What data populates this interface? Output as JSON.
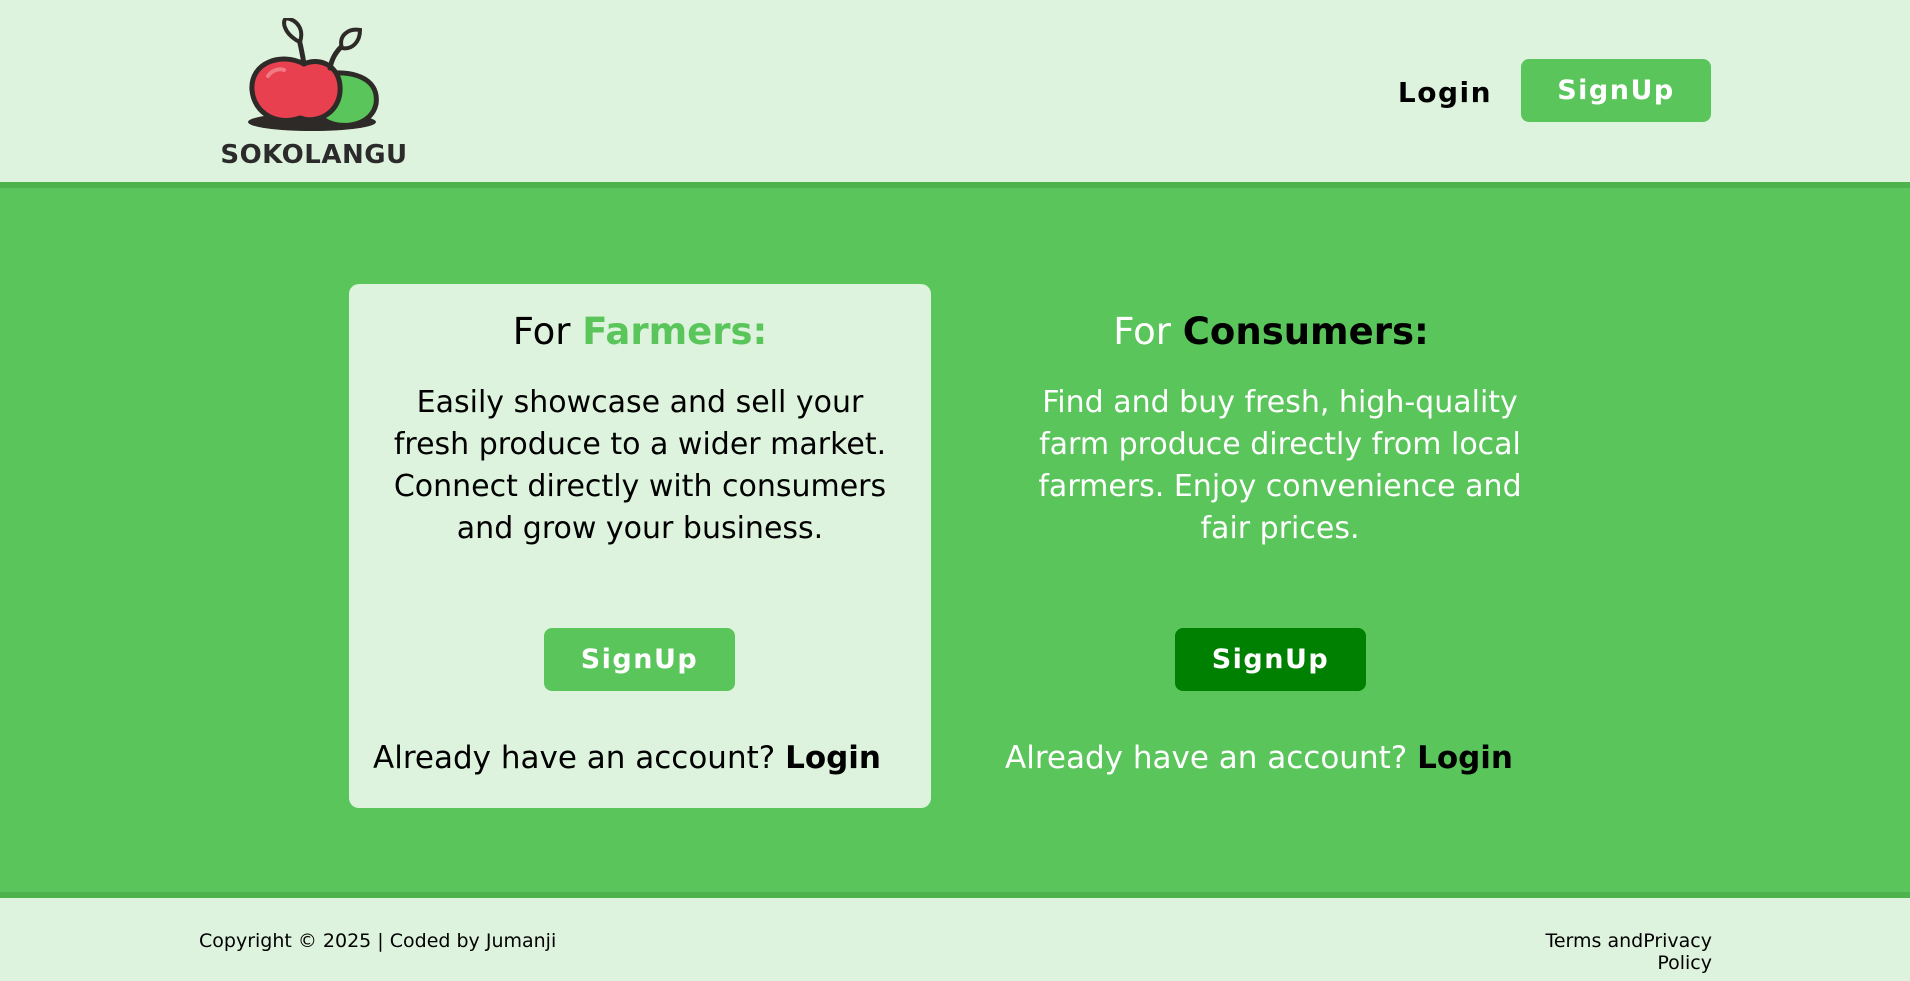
{
  "header": {
    "logo_text": "SOKOLANGU",
    "login_label": "Login",
    "signup_label": "SignUp"
  },
  "farmers": {
    "title_prefix": "For",
    "title_accent": "Farmers:",
    "description": "Easily showcase and sell your fresh produce to a wider market. Connect directly with consumers and grow your business.",
    "signup_label": "SignUp",
    "already_text": "Already have an account?",
    "login_label": "Login"
  },
  "consumers": {
    "title_prefix": "For",
    "title_accent": "Consumers:",
    "description": "Find and buy fresh, high-quality farm produce directly from local farmers. Enjoy convenience and fair prices.",
    "signup_label": "SignUp",
    "already_text": "Already have an account?",
    "login_label": "Login"
  },
  "footer": {
    "copyright": "Copyright © 2025 | Coded by Jumanji",
    "terms": "Terms andPrivacy Policy"
  },
  "colors": {
    "brand_green": "#5ac55a",
    "light_green": "#ddf3dd",
    "dark_green": "#008000",
    "apple_red": "#e8404e"
  },
  "icons": {
    "logo": "apple-logo-icon"
  }
}
